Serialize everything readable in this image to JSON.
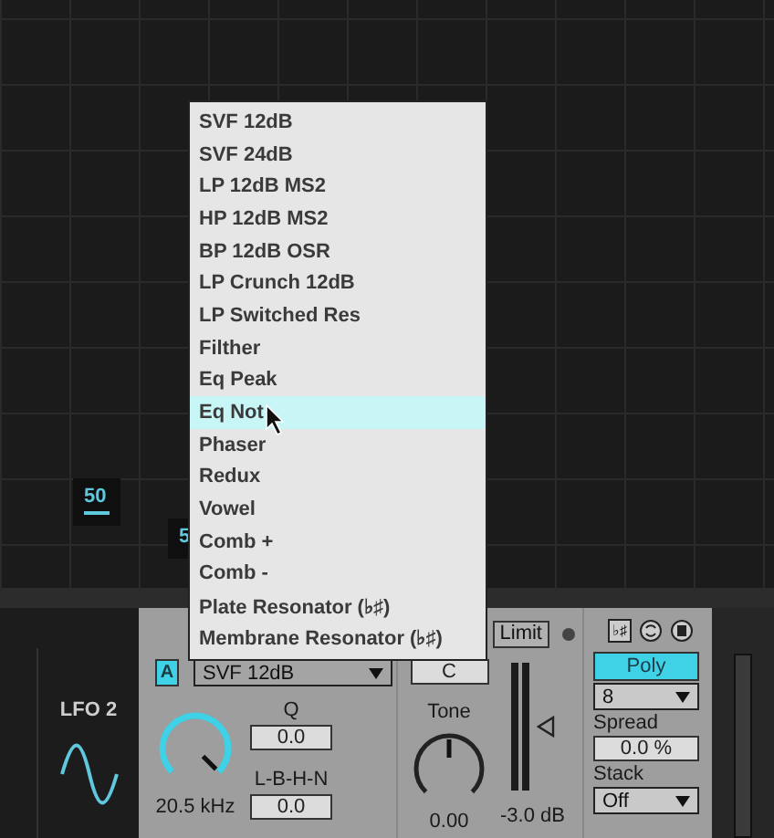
{
  "grid": {
    "labels": [
      "50",
      "5"
    ]
  },
  "menu": {
    "items": [
      {
        "label": "SVF 12dB",
        "selected": false
      },
      {
        "label": "SVF 24dB",
        "selected": false
      },
      {
        "label": "LP 12dB MS2",
        "selected": false
      },
      {
        "label": "HP 12dB MS2",
        "selected": false
      },
      {
        "label": "BP 12dB OSR",
        "selected": false
      },
      {
        "label": "LP Crunch 12dB",
        "selected": false
      },
      {
        "label": "LP Switched Res",
        "selected": false
      },
      {
        "label": "Filther",
        "selected": false
      },
      {
        "label": "Eq Peak",
        "selected": false
      },
      {
        "label": "Eq Not",
        "selected": true
      },
      {
        "label": "Phaser",
        "selected": false
      },
      {
        "label": "Redux",
        "selected": false
      },
      {
        "label": "Vowel",
        "selected": false
      },
      {
        "label": "Comb +",
        "selected": false
      },
      {
        "label": "Comb -",
        "selected": false
      },
      {
        "label": "Plate Resonator  (♭♯)",
        "selected": false
      },
      {
        "label": "Membrane Resonator  (♭♯)",
        "selected": false
      }
    ]
  },
  "lfo": {
    "title": "LFO 2"
  },
  "filter": {
    "badge": "A",
    "badge_on": true,
    "type": "SVF 12dB",
    "frequency": {
      "level": 1,
      "reading": "20.5 kHz"
    },
    "q_label": "Q",
    "q_value": "0.0",
    "morph_label": "L-B-H-N",
    "morph_value": "0.0"
  },
  "amp": {
    "limit": "Limit",
    "key": "C",
    "tone": {
      "label": "Tone",
      "reading": "0.00"
    },
    "volume": "-3.0 dB"
  },
  "voices": {
    "mpe": "♭♯",
    "mode": "Poly",
    "mode_on": true,
    "count": "8",
    "spread_label": "Spread",
    "spread": "0.0 %",
    "stack_label": "Stack",
    "stack": "Off"
  }
}
